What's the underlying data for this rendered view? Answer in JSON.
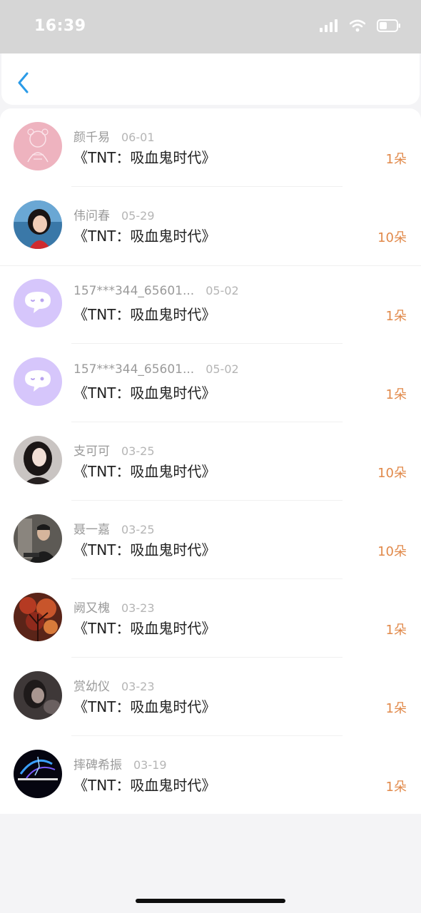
{
  "status_bar": {
    "time": "16:39"
  },
  "nav": {
    "back_icon": "chevron-left-icon"
  },
  "items": [
    {
      "name": "颜千易",
      "date": "06-01",
      "title": "《TNT：吸血鬼时代》",
      "count": "1朵",
      "avatar": "pink-sketch"
    },
    {
      "name": "伟问春",
      "date": "05-29",
      "title": "《TNT：吸血鬼时代》",
      "count": "10朵",
      "avatar": "girl-photo"
    },
    {
      "name": "157***344_65601...",
      "date": "05-02",
      "title": "《TNT：吸血鬼时代》",
      "count": "1朵",
      "avatar": "default-chat-bubble"
    },
    {
      "name": "157***344_65601...",
      "date": "05-02",
      "title": "《TNT：吸血鬼时代》",
      "count": "1朵",
      "avatar": "default-chat-bubble"
    },
    {
      "name": "支可可",
      "date": "03-25",
      "title": "《TNT：吸血鬼时代》",
      "count": "10朵",
      "avatar": "woman-portrait"
    },
    {
      "name": "聂一嘉",
      "date": "03-25",
      "title": "《TNT：吸血鬼时代》",
      "count": "10朵",
      "avatar": "man-phone"
    },
    {
      "name": "阙又槐",
      "date": "03-23",
      "title": "《TNT：吸血鬼时代》",
      "count": "1朵",
      "avatar": "autumn-tree"
    },
    {
      "name": "赏幼仪",
      "date": "03-23",
      "title": "《TNT：吸血鬼时代》",
      "count": "1朵",
      "avatar": "dark-portrait"
    },
    {
      "name": "摔碑希振",
      "date": "03-19",
      "title": "《TNT：吸血鬼时代》",
      "count": "1朵",
      "avatar": "night-text"
    }
  ],
  "colors": {
    "accent_blue": "#2a9be8",
    "count_orange": "#e1894a"
  }
}
